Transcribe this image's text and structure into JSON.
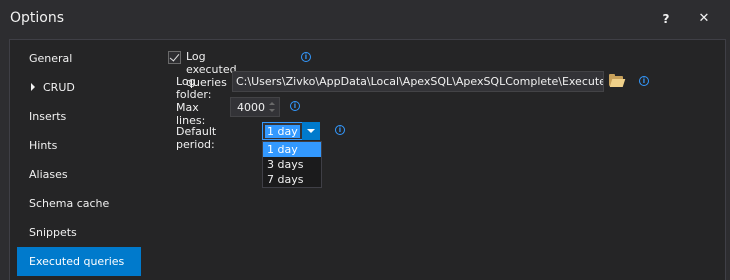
{
  "window": {
    "title": "Options",
    "help_label": "?",
    "close_label": "✕"
  },
  "sidebar": {
    "items": [
      {
        "label": "General"
      },
      {
        "label": "CRUD"
      },
      {
        "label": "Inserts"
      },
      {
        "label": "Hints"
      },
      {
        "label": "Aliases"
      },
      {
        "label": "Schema cache"
      },
      {
        "label": "Snippets"
      },
      {
        "label": "Executed queries"
      }
    ],
    "active": "Executed queries"
  },
  "executed_queries": {
    "log_checkbox_label": "Log executed queries",
    "log_checked": true,
    "log_folder_label": "Log folder:",
    "log_folder_value": "C:\\Users\\Zivko\\AppData\\Local\\ApexSQL\\ApexSQLComplete\\ExecutedQueries",
    "max_lines_label": "Max lines:",
    "max_lines_value": "4000",
    "default_period_label": "Default period:",
    "default_period_value": "1 day",
    "period_options": [
      "1 day",
      "3 days",
      "7 days"
    ]
  },
  "colors": {
    "accent": "#007acc",
    "selection": "#3399ff",
    "background": "#2d2d30",
    "info_icon": "#3399ff"
  },
  "icons": {
    "info": "info-icon",
    "folder": "folder-open-icon",
    "help": "help-icon",
    "close": "close-icon"
  }
}
